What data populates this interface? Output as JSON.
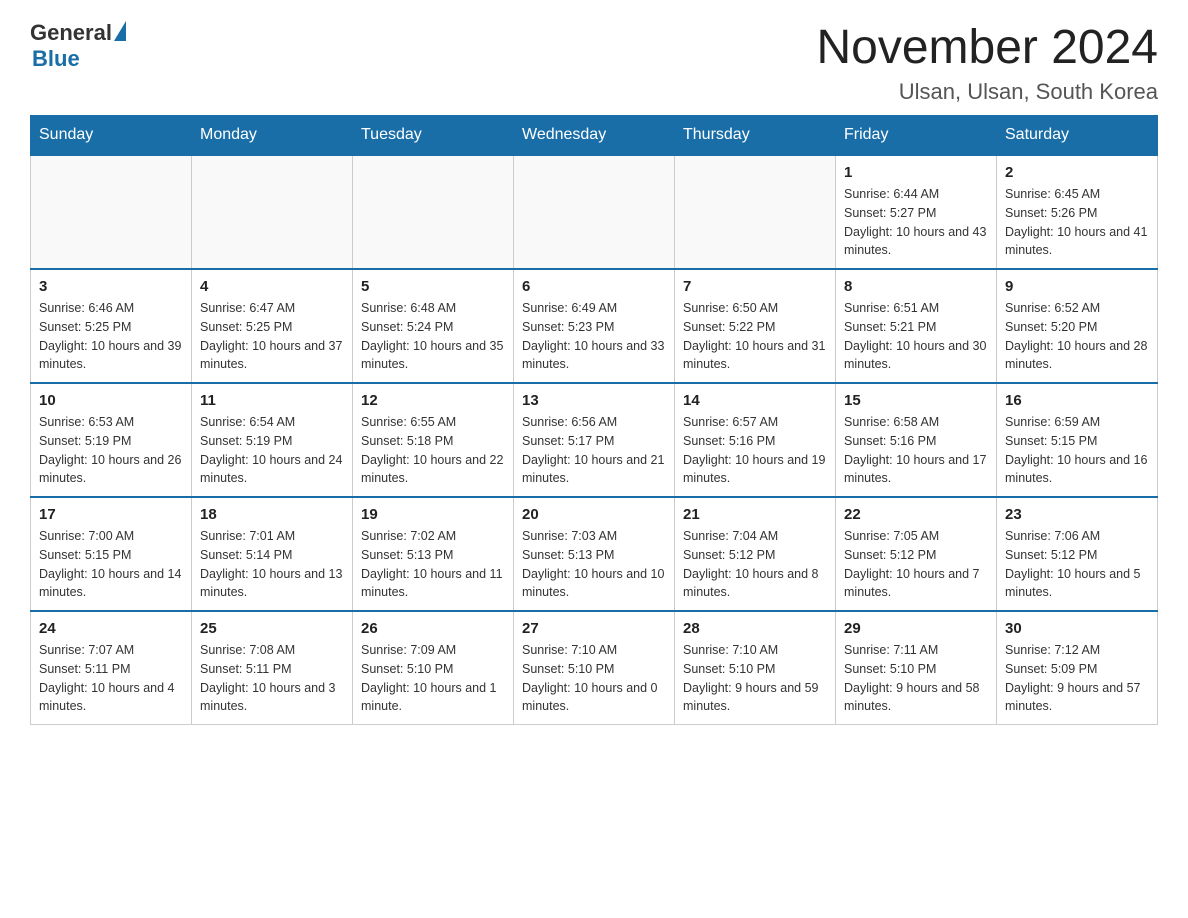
{
  "header": {
    "logo_general": "General",
    "logo_blue": "Blue",
    "title": "November 2024",
    "subtitle": "Ulsan, Ulsan, South Korea"
  },
  "weekdays": [
    "Sunday",
    "Monday",
    "Tuesday",
    "Wednesday",
    "Thursday",
    "Friday",
    "Saturday"
  ],
  "weeks": [
    [
      {
        "day": "",
        "info": ""
      },
      {
        "day": "",
        "info": ""
      },
      {
        "day": "",
        "info": ""
      },
      {
        "day": "",
        "info": ""
      },
      {
        "day": "",
        "info": ""
      },
      {
        "day": "1",
        "info": "Sunrise: 6:44 AM\nSunset: 5:27 PM\nDaylight: 10 hours and 43 minutes."
      },
      {
        "day": "2",
        "info": "Sunrise: 6:45 AM\nSunset: 5:26 PM\nDaylight: 10 hours and 41 minutes."
      }
    ],
    [
      {
        "day": "3",
        "info": "Sunrise: 6:46 AM\nSunset: 5:25 PM\nDaylight: 10 hours and 39 minutes."
      },
      {
        "day": "4",
        "info": "Sunrise: 6:47 AM\nSunset: 5:25 PM\nDaylight: 10 hours and 37 minutes."
      },
      {
        "day": "5",
        "info": "Sunrise: 6:48 AM\nSunset: 5:24 PM\nDaylight: 10 hours and 35 minutes."
      },
      {
        "day": "6",
        "info": "Sunrise: 6:49 AM\nSunset: 5:23 PM\nDaylight: 10 hours and 33 minutes."
      },
      {
        "day": "7",
        "info": "Sunrise: 6:50 AM\nSunset: 5:22 PM\nDaylight: 10 hours and 31 minutes."
      },
      {
        "day": "8",
        "info": "Sunrise: 6:51 AM\nSunset: 5:21 PM\nDaylight: 10 hours and 30 minutes."
      },
      {
        "day": "9",
        "info": "Sunrise: 6:52 AM\nSunset: 5:20 PM\nDaylight: 10 hours and 28 minutes."
      }
    ],
    [
      {
        "day": "10",
        "info": "Sunrise: 6:53 AM\nSunset: 5:19 PM\nDaylight: 10 hours and 26 minutes."
      },
      {
        "day": "11",
        "info": "Sunrise: 6:54 AM\nSunset: 5:19 PM\nDaylight: 10 hours and 24 minutes."
      },
      {
        "day": "12",
        "info": "Sunrise: 6:55 AM\nSunset: 5:18 PM\nDaylight: 10 hours and 22 minutes."
      },
      {
        "day": "13",
        "info": "Sunrise: 6:56 AM\nSunset: 5:17 PM\nDaylight: 10 hours and 21 minutes."
      },
      {
        "day": "14",
        "info": "Sunrise: 6:57 AM\nSunset: 5:16 PM\nDaylight: 10 hours and 19 minutes."
      },
      {
        "day": "15",
        "info": "Sunrise: 6:58 AM\nSunset: 5:16 PM\nDaylight: 10 hours and 17 minutes."
      },
      {
        "day": "16",
        "info": "Sunrise: 6:59 AM\nSunset: 5:15 PM\nDaylight: 10 hours and 16 minutes."
      }
    ],
    [
      {
        "day": "17",
        "info": "Sunrise: 7:00 AM\nSunset: 5:15 PM\nDaylight: 10 hours and 14 minutes."
      },
      {
        "day": "18",
        "info": "Sunrise: 7:01 AM\nSunset: 5:14 PM\nDaylight: 10 hours and 13 minutes."
      },
      {
        "day": "19",
        "info": "Sunrise: 7:02 AM\nSunset: 5:13 PM\nDaylight: 10 hours and 11 minutes."
      },
      {
        "day": "20",
        "info": "Sunrise: 7:03 AM\nSunset: 5:13 PM\nDaylight: 10 hours and 10 minutes."
      },
      {
        "day": "21",
        "info": "Sunrise: 7:04 AM\nSunset: 5:12 PM\nDaylight: 10 hours and 8 minutes."
      },
      {
        "day": "22",
        "info": "Sunrise: 7:05 AM\nSunset: 5:12 PM\nDaylight: 10 hours and 7 minutes."
      },
      {
        "day": "23",
        "info": "Sunrise: 7:06 AM\nSunset: 5:12 PM\nDaylight: 10 hours and 5 minutes."
      }
    ],
    [
      {
        "day": "24",
        "info": "Sunrise: 7:07 AM\nSunset: 5:11 PM\nDaylight: 10 hours and 4 minutes."
      },
      {
        "day": "25",
        "info": "Sunrise: 7:08 AM\nSunset: 5:11 PM\nDaylight: 10 hours and 3 minutes."
      },
      {
        "day": "26",
        "info": "Sunrise: 7:09 AM\nSunset: 5:10 PM\nDaylight: 10 hours and 1 minute."
      },
      {
        "day": "27",
        "info": "Sunrise: 7:10 AM\nSunset: 5:10 PM\nDaylight: 10 hours and 0 minutes."
      },
      {
        "day": "28",
        "info": "Sunrise: 7:10 AM\nSunset: 5:10 PM\nDaylight: 9 hours and 59 minutes."
      },
      {
        "day": "29",
        "info": "Sunrise: 7:11 AM\nSunset: 5:10 PM\nDaylight: 9 hours and 58 minutes."
      },
      {
        "day": "30",
        "info": "Sunrise: 7:12 AM\nSunset: 5:09 PM\nDaylight: 9 hours and 57 minutes."
      }
    ]
  ]
}
